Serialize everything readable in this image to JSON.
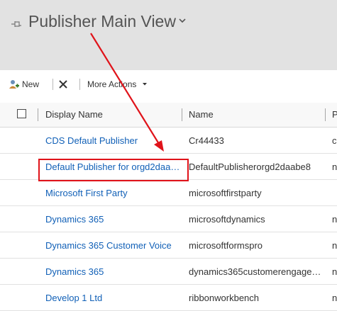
{
  "header": {
    "title": "Publisher Main View",
    "pin_icon": "pin-icon",
    "chevron_icon": "chevron-down-icon"
  },
  "toolbar": {
    "new_label": "New",
    "new_icon": "new-publisher-icon",
    "delete_icon": "close-icon",
    "more_actions_label": "More Actions",
    "more_actions_icon": "caret-down-icon"
  },
  "grid": {
    "columns": [
      "Display Name",
      "Name",
      "P"
    ],
    "rows": [
      {
        "display_name": "CDS Default Publisher",
        "name": "Cr44433",
        "p": "c"
      },
      {
        "display_name": "Default Publisher for orgd2daa…",
        "name": "DefaultPublisherorgd2daabe8",
        "p": "n"
      },
      {
        "display_name": "Microsoft First Party",
        "name": "microsoftfirstparty",
        "p": ""
      },
      {
        "display_name": "Dynamics 365",
        "name": "microsoftdynamics",
        "p": "n"
      },
      {
        "display_name": "Dynamics 365 Customer Voice",
        "name": "microsoftformspro",
        "p": "n"
      },
      {
        "display_name": "Dynamics 365",
        "name": "dynamics365customerengage…",
        "p": "n"
      },
      {
        "display_name": "Develop 1 Ltd",
        "name": "ribbonworkbench",
        "p": "n"
      }
    ]
  },
  "annotation": {
    "color": "#e0131a"
  }
}
